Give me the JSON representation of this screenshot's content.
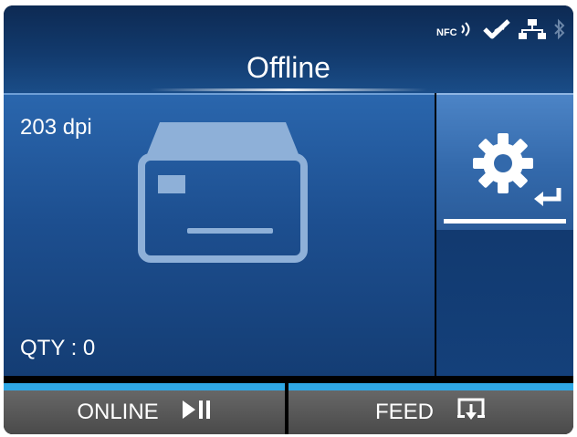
{
  "header": {
    "title": "Offline",
    "status_icons": [
      "nfc-icon",
      "check-signal-icon",
      "network-icon",
      "bluetooth-icon"
    ],
    "nfc_label": "NFC"
  },
  "main": {
    "resolution": "203 dpi",
    "qty_label": "QTY",
    "qty_separator": " : ",
    "qty_value": "0",
    "printer_icon": "printer-media-icon"
  },
  "settings": {
    "icon": "gear-icon",
    "enter_icon": "enter-icon"
  },
  "softkeys": {
    "left_label": "ONLINE",
    "left_icon": "play-pause-icon",
    "right_label": "FEED",
    "right_icon": "feed-icon"
  },
  "colors": {
    "header_bg": "#123a6d",
    "panel_bg": "#1d4f90",
    "settings_bg": "#3369ab",
    "softkey_accent": "#2fa8e6",
    "softkey_bg": "#4a4a4a"
  }
}
